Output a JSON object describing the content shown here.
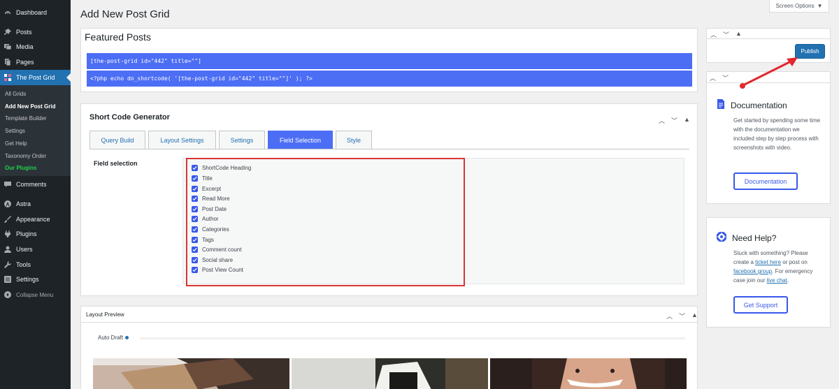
{
  "sidebar": {
    "items": [
      {
        "label": "Dashboard",
        "icon": "dashboard-icon"
      },
      {
        "label": "Posts",
        "icon": "pin-icon"
      },
      {
        "label": "Media",
        "icon": "media-icon"
      },
      {
        "label": "Pages",
        "icon": "page-icon"
      },
      {
        "label": "The Post Grid",
        "icon": "grid-icon"
      },
      {
        "label": "Comments",
        "icon": "comment-icon"
      },
      {
        "label": "Astra",
        "icon": "astra-icon"
      },
      {
        "label": "Appearance",
        "icon": "brush-icon"
      },
      {
        "label": "Plugins",
        "icon": "plug-icon"
      },
      {
        "label": "Users",
        "icon": "user-icon"
      },
      {
        "label": "Tools",
        "icon": "wrench-icon"
      },
      {
        "label": "Settings",
        "icon": "settings-icon"
      },
      {
        "label": "Collapse Menu",
        "icon": "collapse-icon"
      }
    ],
    "submenu": [
      "All Grids",
      "Add New Post Grid",
      "Template Builder",
      "Settings",
      "Get Help",
      "Taxonomy Order",
      "Our Plugins"
    ]
  },
  "header": {
    "title": "Add New Post Grid",
    "screen_options": "Screen Options"
  },
  "post": {
    "title": "Featured Posts",
    "shortcode": "[the-post-grid id=\"442\" title=\"\"]",
    "php_code": "<?php echo do_shortcode( '[the-post-grid id=\"442\" title=\"\"]' ); ?>"
  },
  "generator": {
    "title": "Short Code Generator",
    "tabs": [
      "Query Build",
      "Layout Settings",
      "Settings",
      "Field Selection",
      "Style"
    ],
    "active_tab": "Field Selection",
    "field_label": "Field selection",
    "fields": [
      "ShortCode Heading",
      "Title",
      "Excerpt",
      "Read More",
      "Post Date",
      "Author",
      "Categories",
      "Tags",
      "Comment count",
      "Social share",
      "Post View Count"
    ]
  },
  "preview": {
    "title": "Layout Preview",
    "status": "Auto Draft"
  },
  "publish": {
    "button": "Publish"
  },
  "documentation": {
    "title": "Documentation",
    "text": "Get started by spending some time with the documentation we included step by step process with screenshots with video.",
    "button": "Documentation"
  },
  "help": {
    "title": "Need Help?",
    "text_before": "Stuck with something? Please create a ",
    "link1": "ticket here",
    "text_mid1": " or post on ",
    "link2": "facebook group",
    "text_mid2": ". For emergency case join our ",
    "link3": "live chat",
    "text_after": ".",
    "button": "Get Support"
  },
  "colors": {
    "sidebar_bg": "#1d2327",
    "active_menu": "#2271b1",
    "accent_blue": "#4c6ef5",
    "highlight_red": "#d63638"
  }
}
